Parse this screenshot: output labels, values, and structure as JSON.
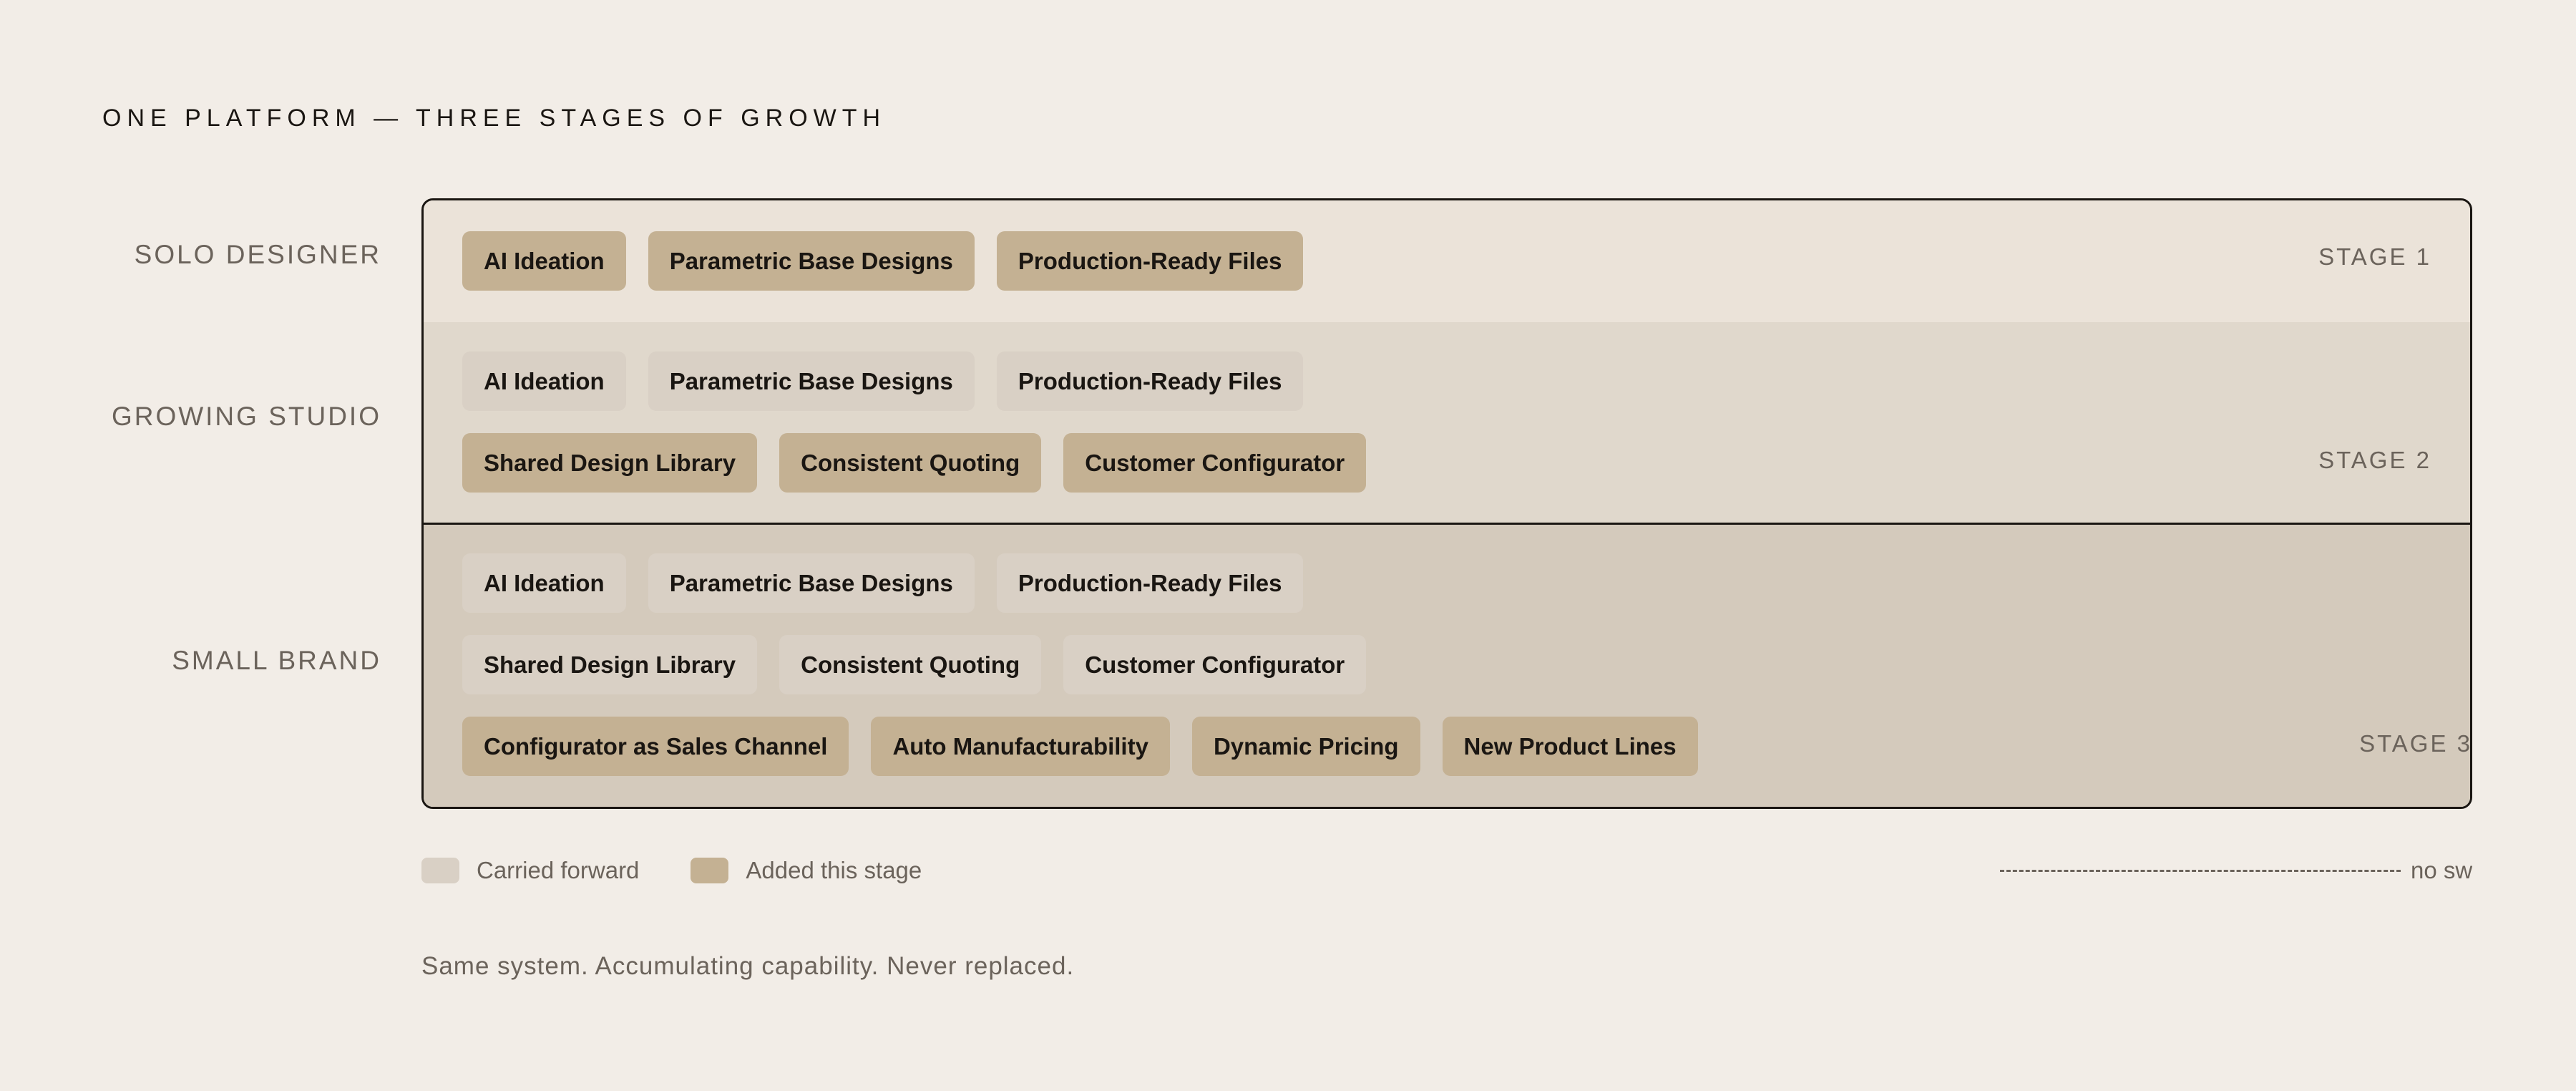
{
  "title": "ONE PLATFORM — THREE STAGES OF GROWTH",
  "rows": [
    {
      "label": "SOLO DESIGNER",
      "stage": "STAGE 1"
    },
    {
      "label": "GROWING STUDIO",
      "stage": "STAGE 2"
    },
    {
      "label": "SMALL BRAND",
      "stage": "STAGE 3"
    }
  ],
  "capabilities": {
    "group1": [
      "AI Ideation",
      "Parametric Base Designs",
      "Production-Ready Files"
    ],
    "group2": [
      "Shared Design Library",
      "Consistent Quoting",
      "Customer Configurator"
    ],
    "group3": [
      "Configurator as Sales Channel",
      "Auto Manufacturability",
      "Dynamic Pricing",
      "New Product Lines"
    ]
  },
  "legend": {
    "carried": "Carried forward",
    "added": "Added this stage",
    "no_swap": "no swa"
  },
  "tagline": "Same system. Accumulating capability. Never replaced.",
  "colors": {
    "background": "#f2ede7",
    "carried_chip": "#d9d0c5",
    "added_chip": "#c4b193",
    "stage1_bg": "#ebe3d9",
    "stage2_bg": "#e0d8cc",
    "stage3_bg": "#d4cabc"
  }
}
